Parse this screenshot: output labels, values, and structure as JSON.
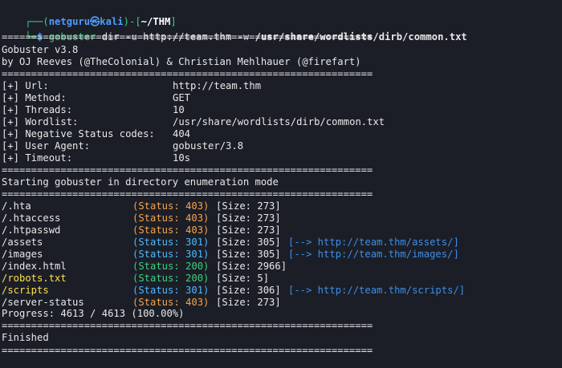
{
  "prompt": {
    "user": "netguru",
    "host": "kali",
    "path": "~/THM",
    "symbol": "$",
    "corner_top": "┌──",
    "corner_bottom": "└─",
    "open_paren": "(",
    "close_paren": ")",
    "separator": "-",
    "at_icon": "㉿",
    "bracket_open": "[",
    "bracket_close": "]"
  },
  "command": {
    "tool": "gobuster",
    "subcommand": "dir",
    "flag_u": "-u",
    "target": "http://team.thm",
    "flag_w": "-w",
    "wordlist": "/usr/share/wordlists/dirb/common.txt"
  },
  "banner": {
    "separator": "===============================================================",
    "title": "Gobuster v3.8",
    "authors": "by OJ Reeves (@TheColonial) & Christian Mehlhauer (@firefart)"
  },
  "config": [
    {
      "label": "[+] Url:",
      "value": "http://team.thm"
    },
    {
      "label": "[+] Method:",
      "value": "GET"
    },
    {
      "label": "[+] Threads:",
      "value": "10"
    },
    {
      "label": "[+] Wordlist:",
      "value": "/usr/share/wordlists/dirb/common.txt"
    },
    {
      "label": "[+] Negative Status codes:",
      "value": "404"
    },
    {
      "label": "[+] User Agent:",
      "value": "gobuster/3.8"
    },
    {
      "label": "[+] Timeout:",
      "value": "10s"
    }
  ],
  "start_message": "Starting gobuster in directory enumeration mode",
  "results": [
    {
      "path": "/.hta",
      "status": "(Status: 403)",
      "code": 403,
      "size": "[Size: 273]",
      "redirect": "",
      "highlight": false
    },
    {
      "path": "/.htaccess",
      "status": "(Status: 403)",
      "code": 403,
      "size": "[Size: 273]",
      "redirect": "",
      "highlight": false
    },
    {
      "path": "/.htpasswd",
      "status": "(Status: 403)",
      "code": 403,
      "size": "[Size: 273]",
      "redirect": "",
      "highlight": false
    },
    {
      "path": "/assets",
      "status": "(Status: 301)",
      "code": 301,
      "size": "[Size: 305]",
      "redirect": "[--> http://team.thm/assets/]",
      "highlight": false
    },
    {
      "path": "/images",
      "status": "(Status: 301)",
      "code": 301,
      "size": "[Size: 305]",
      "redirect": "[--> http://team.thm/images/]",
      "highlight": false
    },
    {
      "path": "/index.html",
      "status": "(Status: 200)",
      "code": 200,
      "size": "[Size: 2966]",
      "redirect": "",
      "highlight": false
    },
    {
      "path": "/robots.txt",
      "status": "(Status: 200)",
      "code": 200,
      "size": "[Size: 5]",
      "redirect": "",
      "highlight": true
    },
    {
      "path": "/scripts",
      "status": "(Status: 301)",
      "code": 301,
      "size": "[Size: 306]",
      "redirect": "[--> http://team.thm/scripts/]",
      "highlight": true
    },
    {
      "path": "/server-status",
      "status": "(Status: 403)",
      "code": 403,
      "size": "[Size: 273]",
      "redirect": "",
      "highlight": false
    }
  ],
  "progress": "Progress: 4613 / 4613 (100.00%)",
  "finished": "Finished",
  "colors": {
    "background": "#1b1e27",
    "text": "#e8e8e8",
    "prompt_green": "#3ed07e",
    "prompt_blue": "#4f9cff",
    "status_403": "#f5a34d",
    "status_301": "#4fb8ff",
    "status_200": "#3ed07e",
    "highlight_yellow": "#ffe04a",
    "redirect_blue": "#3d8ee6"
  }
}
